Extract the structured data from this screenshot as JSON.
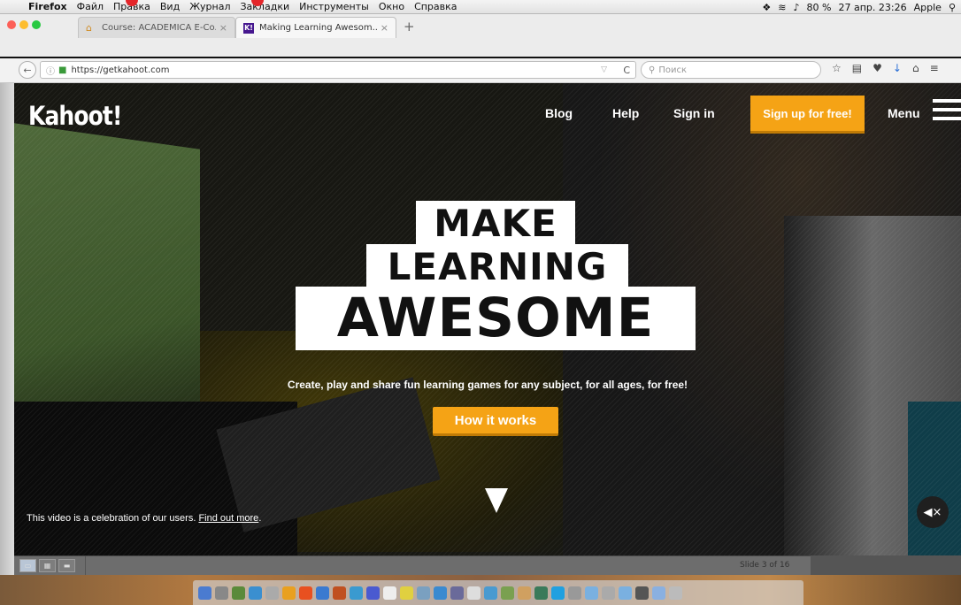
{
  "menubar": {
    "app": "Firefox",
    "items": [
      "Файл",
      "Правка",
      "Вид",
      "Журнал",
      "Закладки",
      "Инструменты",
      "Окно",
      "Справка"
    ],
    "battery": "80 %",
    "datetime": "27 апр. 23:26",
    "user": "Apple"
  },
  "tabs": [
    {
      "title": "Course: ACADEMICA E-Co...",
      "active": false
    },
    {
      "title": "Making Learning Awesom...",
      "active": true
    }
  ],
  "navbar": {
    "url": "https://getkahoot.com",
    "search_placeholder": "Поиск"
  },
  "site": {
    "logo": "Kahoot!",
    "nav": {
      "blog": "Blog",
      "help": "Help",
      "signin": "Sign in",
      "signup": "Sign up for free!",
      "menu": "Menu"
    },
    "headline": [
      "MAKE",
      "LEARNING",
      "AWESOME"
    ],
    "tagline": "Create, play and share fun learning games for any subject, for all ages, for free!",
    "cta": "How it works",
    "caption": "This video is a celebration of our users. ",
    "caption_link": "Find out more",
    "caption_end": ".",
    "accent": "#f5a315"
  },
  "slideshow": {
    "slide_label": "Slide 3 of 16"
  }
}
